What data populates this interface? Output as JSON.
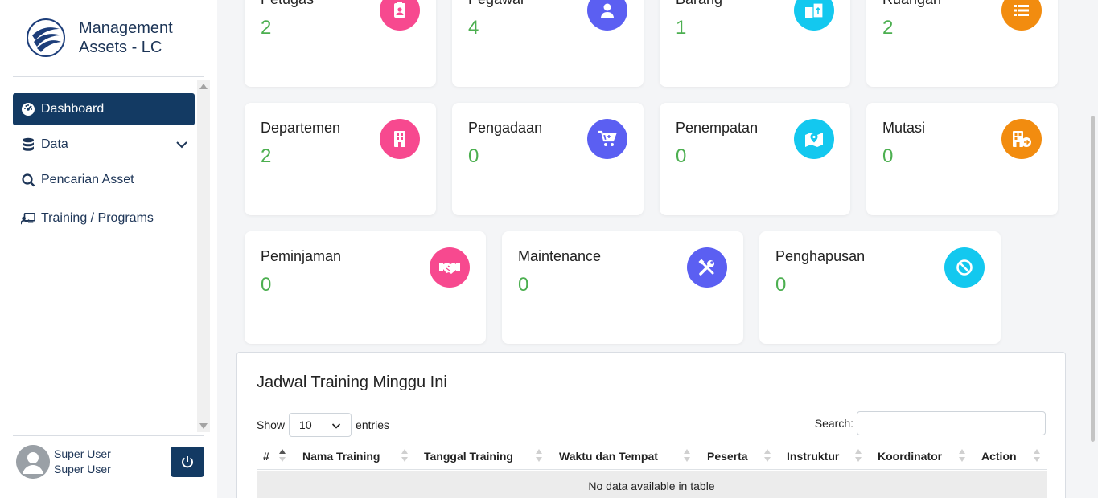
{
  "brand": {
    "line1": "Management",
    "line2": "Assets - LC"
  },
  "nav": {
    "dashboard": "Dashboard",
    "data": "Data",
    "search_asset": "Pencarian Asset",
    "training": "Training / Programs"
  },
  "user": {
    "name": "Super User",
    "role": "Super User"
  },
  "cards_row1": [
    {
      "title": "Petugas",
      "value": "2",
      "color": "#f7498f",
      "icon": "id-badge-icon"
    },
    {
      "title": "Pegawai",
      "value": "4",
      "color": "#5b5ff2",
      "icon": "user-icon"
    },
    {
      "title": "Barang",
      "value": "1",
      "color": "#13c8ef",
      "icon": "boxes-icon"
    },
    {
      "title": "Ruangan",
      "value": "2",
      "color": "#f28c0f",
      "icon": "list-icon"
    }
  ],
  "cards_row2": [
    {
      "title": "Departemen",
      "value": "2",
      "color": "#f7498f",
      "icon": "building-icon"
    },
    {
      "title": "Pengadaan",
      "value": "0",
      "color": "#5b5ff2",
      "icon": "cart-icon"
    },
    {
      "title": "Penempatan",
      "value": "0",
      "color": "#13c8ef",
      "icon": "map-location-icon"
    },
    {
      "title": "Mutasi",
      "value": "0",
      "color": "#f28c0f",
      "icon": "building-arrow-icon"
    }
  ],
  "cards_row3": [
    {
      "title": "Peminjaman",
      "value": "0",
      "color": "#f7498f",
      "icon": "handshake-icon"
    },
    {
      "title": "Maintenance",
      "value": "0",
      "color": "#5b5ff2",
      "icon": "tools-icon"
    },
    {
      "title": "Penghapusan",
      "value": "0",
      "color": "#13c8ef",
      "icon": "ban-icon"
    }
  ],
  "training_table": {
    "title": "Jadwal Training Minggu Ini",
    "show_label": "Show",
    "entries_value": "10",
    "entries_label": "entries",
    "search_label": "Search:",
    "columns": [
      "#",
      "Nama Training",
      "Tanggal Training",
      "Waktu dan Tempat",
      "Peserta",
      "Instruktur",
      "Koordinator",
      "Action"
    ],
    "empty_message": "No data available in table"
  }
}
